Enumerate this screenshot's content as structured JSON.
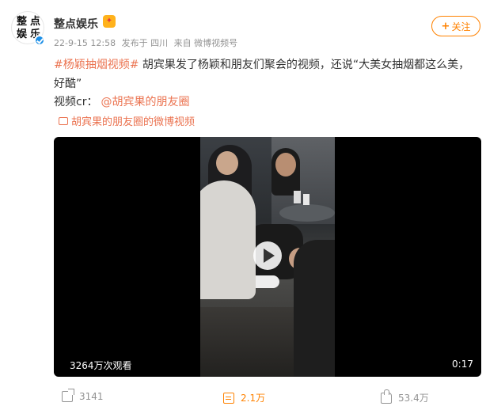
{
  "author": {
    "name": "整点娱乐",
    "avatar_chars": [
      "整",
      "点",
      "娱",
      "乐"
    ],
    "badge_icon": "vip-fan-badge-icon",
    "verified": true
  },
  "post_meta": {
    "date": "22-9-15 12:58",
    "location": "发布于 四川",
    "source": "来自 微博视频号"
  },
  "follow_button": {
    "label": "关注",
    "icon": "plus-icon"
  },
  "content": {
    "topic": "#杨颖抽烟视频#",
    "text": " 胡宾果发了杨颖和朋友们聚会的视频，还说“大美女抽烟都这么美，好酷”",
    "credit_prefix": "视频cr：",
    "mention": "@胡宾果的朋友圈",
    "video_link": "胡宾果的朋友圈的微博视频"
  },
  "video": {
    "views": "3264万次观看",
    "duration": "0:17",
    "play_icon": "play-icon"
  },
  "actions": {
    "share_count": "3141",
    "comment_count": "2.1万",
    "like_count": "53.4万"
  },
  "colors": {
    "accent": "#ff8200",
    "link": "#eb7350",
    "meta_text": "#939393",
    "verified": "#1a8ee6"
  }
}
